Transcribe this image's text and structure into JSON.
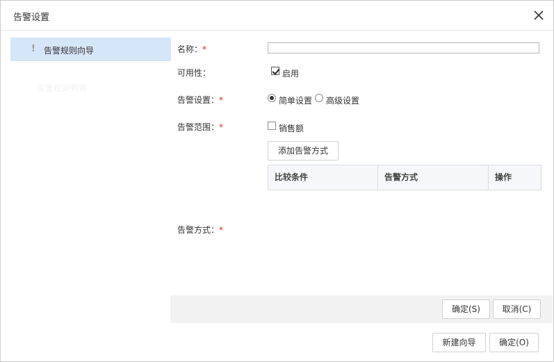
{
  "dialog": {
    "title": "告警设置"
  },
  "sidebar": {
    "items": [
      {
        "label": "告警规则向导",
        "active": true,
        "icon": "exclamation-icon"
      },
      {
        "label": "告警规则列表",
        "active": false
      }
    ]
  },
  "form": {
    "name_label": "名称：",
    "name_required": "*",
    "name_value": "",
    "availability_label": "可用性：",
    "enable_label": "启用",
    "enable_checked": true,
    "alert_setting_label": "告警设置：",
    "alert_setting_required": "*",
    "simple_setting_label": "简单设置",
    "advanced_setting_label": "高级设置",
    "selected_setting": "简单设置",
    "alert_range_label": "告警范围：",
    "alert_range_required": "*",
    "sales_label": "销售额",
    "sales_checked": false,
    "add_alert_method_label": "添加告警方式",
    "alert_method_label": "告警方式：",
    "alert_method_required": "*"
  },
  "table": {
    "columns": [
      "比较条件",
      "告警方式",
      "操作"
    ],
    "rows": []
  },
  "content_footer": {
    "confirm_label": "确定(S)",
    "cancel_label": "取消(C)"
  },
  "dialog_footer": {
    "new_wizard_label": "新建向导",
    "ok_label": "确定(O)"
  },
  "colors": {
    "active_item_bg": "#d6e6f9",
    "required": "#e02020",
    "footer_bg": "#f2f2f2"
  }
}
